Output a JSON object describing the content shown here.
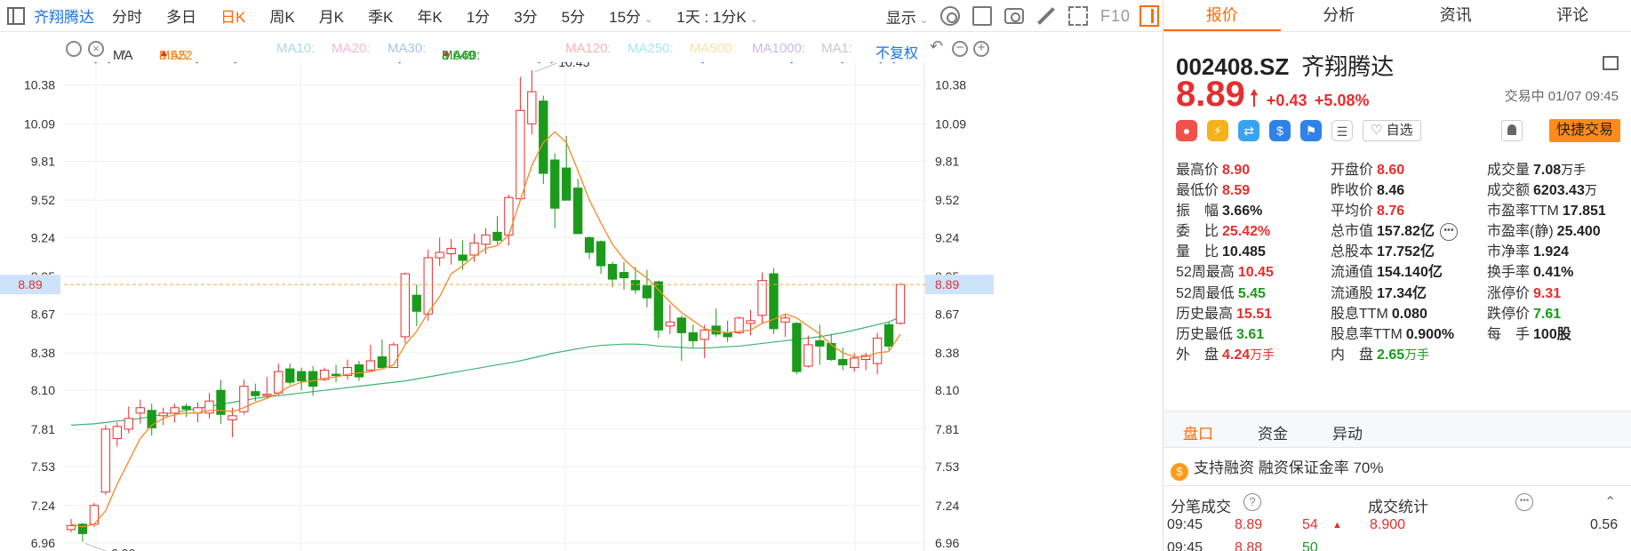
{
  "toolbar": {
    "stock_name": "齐翔腾达",
    "periods": [
      "分时",
      "多日",
      "日K",
      "周K",
      "月K",
      "季K",
      "年K",
      "1分",
      "3分",
      "5分",
      "15分"
    ],
    "active_period": "日K",
    "compare_label": "1天 : 1分K",
    "display_label": "显示",
    "f10_label": "F10"
  },
  "ma_bar": {
    "ma_label": "MA",
    "ma5_label": "MA5:",
    "ma5_value": "8.522",
    "ma10": "MA10:",
    "ma20": "MA20:",
    "ma30": "MA30:",
    "ma60_label": "MA60:",
    "ma60_value": "8.649",
    "ma120": "MA120:",
    "ma250": "MA250:",
    "ma500": "MA500:",
    "ma1000": "MA1000:",
    "ma1": "MA1:",
    "adjust_label": "不复权"
  },
  "chart_data": {
    "type": "candlestick",
    "y_ticks": [
      "10.38",
      "10.09",
      "9.81",
      "9.52",
      "9.24",
      "8.95",
      "8.67",
      "8.38",
      "8.10",
      "7.81",
      "7.53",
      "7.24",
      "6.96"
    ],
    "ylim": [
      6.9,
      10.55
    ],
    "current_price": "8.89",
    "high_label": "10.45",
    "low_label": "6.96",
    "candles": [
      [
        7.06,
        7.14,
        7.04,
        7.09
      ],
      [
        7.1,
        7.11,
        6.97,
        7.03
      ],
      [
        7.1,
        7.26,
        7.08,
        7.24
      ],
      [
        7.34,
        7.84,
        7.32,
        7.81
      ],
      [
        7.74,
        7.86,
        7.68,
        7.83
      ],
      [
        7.81,
        7.98,
        7.78,
        7.89
      ],
      [
        7.93,
        8.03,
        7.85,
        7.97
      ],
      [
        7.95,
        8.0,
        7.76,
        7.82
      ],
      [
        7.91,
        7.97,
        7.84,
        7.93
      ],
      [
        7.93,
        8.0,
        7.86,
        7.97
      ],
      [
        7.98,
        8.0,
        7.9,
        7.96
      ],
      [
        7.93,
        8.01,
        7.86,
        7.97
      ],
      [
        7.93,
        8.08,
        7.89,
        8.02
      ],
      [
        8.1,
        8.18,
        7.85,
        7.92
      ],
      [
        7.88,
        7.97,
        7.75,
        7.91
      ],
      [
        7.94,
        8.18,
        7.92,
        8.13
      ],
      [
        8.09,
        8.15,
        8.02,
        8.06
      ],
      [
        8.06,
        8.2,
        8.05,
        8.07
      ],
      [
        8.08,
        8.3,
        8.06,
        8.24
      ],
      [
        8.26,
        8.3,
        8.14,
        8.16
      ],
      [
        8.24,
        8.27,
        8.1,
        8.17
      ],
      [
        8.24,
        8.28,
        8.06,
        8.13
      ],
      [
        8.18,
        8.27,
        8.17,
        8.25
      ],
      [
        8.22,
        8.29,
        8.16,
        8.21
      ],
      [
        8.21,
        8.33,
        8.18,
        8.27
      ],
      [
        8.29,
        8.32,
        8.17,
        8.2
      ],
      [
        8.25,
        8.44,
        8.24,
        8.32
      ],
      [
        8.35,
        8.48,
        8.27,
        8.27
      ],
      [
        8.27,
        8.46,
        8.27,
        8.44
      ],
      [
        8.5,
        8.98,
        8.45,
        8.97
      ],
      [
        8.81,
        8.89,
        8.58,
        8.69
      ],
      [
        8.67,
        9.15,
        8.62,
        9.09
      ],
      [
        9.09,
        9.24,
        9.03,
        9.13
      ],
      [
        9.12,
        9.23,
        9.04,
        9.16
      ],
      [
        9.11,
        9.22,
        9.0,
        9.07
      ],
      [
        9.11,
        9.27,
        9.06,
        9.2
      ],
      [
        9.19,
        9.31,
        9.12,
        9.26
      ],
      [
        9.28,
        9.4,
        9.19,
        9.22
      ],
      [
        9.26,
        9.56,
        9.18,
        9.54
      ],
      [
        9.53,
        10.44,
        9.52,
        10.19
      ],
      [
        10.09,
        10.49,
        10.01,
        10.33
      ],
      [
        10.26,
        10.3,
        9.64,
        9.72
      ],
      [
        9.82,
        9.87,
        9.31,
        9.46
      ],
      [
        9.76,
        10.0,
        9.58,
        9.52
      ],
      [
        9.61,
        9.68,
        9.29,
        9.27
      ],
      [
        9.24,
        9.25,
        9.08,
        9.13
      ],
      [
        9.21,
        9.22,
        8.97,
        9.03
      ],
      [
        9.04,
        9.06,
        8.87,
        8.93
      ],
      [
        8.98,
        9.06,
        8.85,
        8.94
      ],
      [
        8.92,
        9.02,
        8.82,
        8.85
      ],
      [
        8.88,
        9.0,
        8.72,
        8.79
      ],
      [
        8.91,
        8.92,
        8.49,
        8.55
      ],
      [
        8.58,
        8.74,
        8.52,
        8.61
      ],
      [
        8.64,
        8.66,
        8.32,
        8.53
      ],
      [
        8.53,
        8.59,
        8.42,
        8.47
      ],
      [
        8.48,
        8.59,
        8.34,
        8.55
      ],
      [
        8.58,
        8.71,
        8.5,
        8.52
      ],
      [
        8.53,
        8.62,
        8.46,
        8.5
      ],
      [
        8.53,
        8.65,
        8.52,
        8.64
      ],
      [
        8.6,
        8.7,
        8.51,
        8.62
      ],
      [
        8.66,
        8.98,
        8.6,
        8.92
      ],
      [
        8.97,
        9.01,
        8.52,
        8.56
      ],
      [
        8.61,
        8.67,
        8.5,
        8.64
      ],
      [
        8.6,
        8.61,
        8.22,
        8.24
      ],
      [
        8.28,
        8.51,
        8.27,
        8.44
      ],
      [
        8.47,
        8.59,
        8.29,
        8.43
      ],
      [
        8.45,
        8.52,
        8.32,
        8.33
      ],
      [
        8.33,
        8.42,
        8.25,
        8.29
      ],
      [
        8.27,
        8.38,
        8.24,
        8.34
      ],
      [
        8.33,
        8.38,
        8.25,
        8.36
      ],
      [
        8.3,
        8.53,
        8.22,
        8.49
      ],
      [
        8.59,
        8.61,
        8.4,
        8.43
      ],
      [
        8.6,
        8.9,
        8.59,
        8.89
      ]
    ],
    "ma5": [
      7.1,
      7.08,
      7.1,
      7.2,
      7.4,
      7.57,
      7.74,
      7.84,
      7.89,
      7.92,
      7.93,
      7.93,
      7.95,
      7.95,
      7.94,
      7.97,
      8.01,
      8.04,
      8.08,
      8.13,
      8.16,
      8.17,
      8.19,
      8.2,
      8.22,
      8.23,
      8.24,
      8.26,
      8.29,
      8.44,
      8.54,
      8.68,
      8.8,
      8.97,
      9.03,
      9.1,
      9.16,
      9.18,
      9.26,
      9.52,
      9.78,
      9.95,
      10.03,
      9.95,
      9.74,
      9.52,
      9.35,
      9.19,
      9.08,
      9.0,
      8.94,
      8.85,
      8.76,
      8.68,
      8.62,
      8.56,
      8.54,
      8.53,
      8.54,
      8.55,
      8.6,
      8.63,
      8.67,
      8.64,
      8.58,
      8.52,
      8.44,
      8.38,
      8.35,
      8.35,
      8.38,
      8.39,
      8.52
    ],
    "ma60": [
      7.84,
      7.845,
      7.85,
      7.86,
      7.87,
      7.88,
      7.89,
      7.905,
      7.92,
      7.935,
      7.95,
      7.965,
      7.98,
      7.995,
      8.01,
      8.025,
      8.04,
      8.05,
      8.06,
      8.07,
      8.08,
      8.09,
      8.1,
      8.11,
      8.12,
      8.13,
      8.14,
      8.15,
      8.16,
      8.17,
      8.185,
      8.2,
      8.215,
      8.23,
      8.245,
      8.26,
      8.275,
      8.29,
      8.305,
      8.32,
      8.34,
      8.36,
      8.38,
      8.395,
      8.41,
      8.425,
      8.435,
      8.44,
      8.445,
      8.445,
      8.44,
      8.43,
      8.425,
      8.42,
      8.415,
      8.415,
      8.42,
      8.425,
      8.43,
      8.44,
      8.45,
      8.46,
      8.47,
      8.48,
      8.49,
      8.5,
      8.515,
      8.53,
      8.55,
      8.57,
      8.59,
      8.61,
      8.649
    ]
  },
  "right_panel": {
    "tabs": [
      "报价",
      "分析",
      "资讯",
      "评论"
    ],
    "active_tab": "报价",
    "code": "002408.SZ",
    "name": "齐翔腾达",
    "price": "8.89",
    "change": "+0.43",
    "change_pct": "+5.08%",
    "status": "交易中 01/07 09:45",
    "watch_label": "自选",
    "quick_trade_label": "快捷交易",
    "stats": [
      [
        [
          "最高价",
          "8.90",
          "red"
        ],
        [
          "开盘价",
          "8.60",
          "red"
        ],
        [
          "成交量",
          "7.08",
          "blk",
          "万手"
        ]
      ],
      [
        [
          "最低价",
          "8.59",
          "red"
        ],
        [
          "昨收价",
          "8.46",
          "blk"
        ],
        [
          "成交额",
          "6203.43",
          "blk",
          "万"
        ]
      ],
      [
        [
          "振　幅",
          "3.66%",
          "blk"
        ],
        [
          "平均价",
          "8.76",
          "red"
        ],
        [
          "市盈率TTM",
          "17.851",
          "blk"
        ]
      ],
      [
        [
          "委　比",
          "25.42%",
          "red"
        ],
        [
          "总市值",
          "157.82亿",
          "blk"
        ],
        [
          "市盈率(静)",
          "25.400",
          "blk"
        ]
      ],
      [
        [
          "量　比",
          "10.485",
          "blk"
        ],
        [
          "总股本",
          "17.752亿",
          "blk"
        ],
        [
          "市净率",
          "1.924",
          "blk"
        ]
      ],
      [
        [
          "52周最高",
          "10.45",
          "red"
        ],
        [
          "流通值",
          "154.140亿",
          "blk"
        ],
        [
          "换手率",
          "0.41%",
          "blk"
        ]
      ],
      [
        [
          "52周最低",
          "5.45",
          "green"
        ],
        [
          "流通股",
          "17.34亿",
          "blk"
        ],
        [
          "涨停价",
          "9.31",
          "red"
        ]
      ],
      [
        [
          "历史最高",
          "15.51",
          "red"
        ],
        [
          "股息TTM",
          "0.080",
          "blk"
        ],
        [
          "跌停价",
          "7.61",
          "green"
        ]
      ],
      [
        [
          "历史最低",
          "3.61",
          "green"
        ],
        [
          "股息率TTM",
          "0.900%",
          "blk"
        ],
        [
          "每　手",
          "100股",
          "blk"
        ]
      ],
      [
        [
          "外　盘",
          "4.24",
          "red",
          "万手"
        ],
        [
          "内　盘",
          "2.65",
          "green",
          "万手"
        ]
      ]
    ],
    "sub_tabs": [
      "盘口",
      "资金",
      "异动"
    ],
    "margin_text": "支持融资 融资保证金率 70%",
    "ticks_title": "分笔成交",
    "trade_stats_title": "成交统计",
    "ticks": [
      {
        "time": "09:45",
        "price": "8.89",
        "vol": "54"
      },
      {
        "time": "09:45",
        "price": "8.88",
        "vol": "50"
      }
    ],
    "stat_price": "8.900",
    "stat_vol": "0.56"
  }
}
